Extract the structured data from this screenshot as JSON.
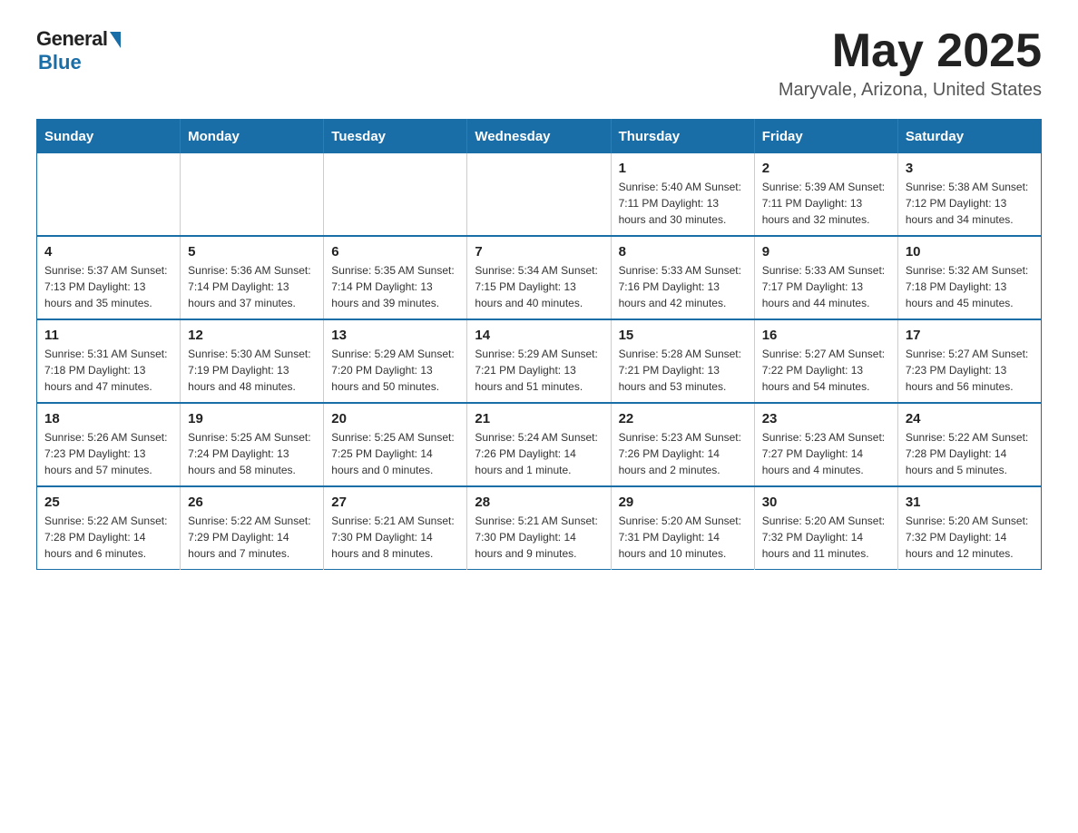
{
  "logo": {
    "general": "General",
    "blue": "Blue"
  },
  "title": {
    "month": "May 2025",
    "location": "Maryvale, Arizona, United States"
  },
  "calendar": {
    "headers": [
      "Sunday",
      "Monday",
      "Tuesday",
      "Wednesday",
      "Thursday",
      "Friday",
      "Saturday"
    ],
    "rows": [
      [
        {
          "day": "",
          "info": ""
        },
        {
          "day": "",
          "info": ""
        },
        {
          "day": "",
          "info": ""
        },
        {
          "day": "",
          "info": ""
        },
        {
          "day": "1",
          "info": "Sunrise: 5:40 AM\nSunset: 7:11 PM\nDaylight: 13 hours and 30 minutes."
        },
        {
          "day": "2",
          "info": "Sunrise: 5:39 AM\nSunset: 7:11 PM\nDaylight: 13 hours and 32 minutes."
        },
        {
          "day": "3",
          "info": "Sunrise: 5:38 AM\nSunset: 7:12 PM\nDaylight: 13 hours and 34 minutes."
        }
      ],
      [
        {
          "day": "4",
          "info": "Sunrise: 5:37 AM\nSunset: 7:13 PM\nDaylight: 13 hours and 35 minutes."
        },
        {
          "day": "5",
          "info": "Sunrise: 5:36 AM\nSunset: 7:14 PM\nDaylight: 13 hours and 37 minutes."
        },
        {
          "day": "6",
          "info": "Sunrise: 5:35 AM\nSunset: 7:14 PM\nDaylight: 13 hours and 39 minutes."
        },
        {
          "day": "7",
          "info": "Sunrise: 5:34 AM\nSunset: 7:15 PM\nDaylight: 13 hours and 40 minutes."
        },
        {
          "day": "8",
          "info": "Sunrise: 5:33 AM\nSunset: 7:16 PM\nDaylight: 13 hours and 42 minutes."
        },
        {
          "day": "9",
          "info": "Sunrise: 5:33 AM\nSunset: 7:17 PM\nDaylight: 13 hours and 44 minutes."
        },
        {
          "day": "10",
          "info": "Sunrise: 5:32 AM\nSunset: 7:18 PM\nDaylight: 13 hours and 45 minutes."
        }
      ],
      [
        {
          "day": "11",
          "info": "Sunrise: 5:31 AM\nSunset: 7:18 PM\nDaylight: 13 hours and 47 minutes."
        },
        {
          "day": "12",
          "info": "Sunrise: 5:30 AM\nSunset: 7:19 PM\nDaylight: 13 hours and 48 minutes."
        },
        {
          "day": "13",
          "info": "Sunrise: 5:29 AM\nSunset: 7:20 PM\nDaylight: 13 hours and 50 minutes."
        },
        {
          "day": "14",
          "info": "Sunrise: 5:29 AM\nSunset: 7:21 PM\nDaylight: 13 hours and 51 minutes."
        },
        {
          "day": "15",
          "info": "Sunrise: 5:28 AM\nSunset: 7:21 PM\nDaylight: 13 hours and 53 minutes."
        },
        {
          "day": "16",
          "info": "Sunrise: 5:27 AM\nSunset: 7:22 PM\nDaylight: 13 hours and 54 minutes."
        },
        {
          "day": "17",
          "info": "Sunrise: 5:27 AM\nSunset: 7:23 PM\nDaylight: 13 hours and 56 minutes."
        }
      ],
      [
        {
          "day": "18",
          "info": "Sunrise: 5:26 AM\nSunset: 7:23 PM\nDaylight: 13 hours and 57 minutes."
        },
        {
          "day": "19",
          "info": "Sunrise: 5:25 AM\nSunset: 7:24 PM\nDaylight: 13 hours and 58 minutes."
        },
        {
          "day": "20",
          "info": "Sunrise: 5:25 AM\nSunset: 7:25 PM\nDaylight: 14 hours and 0 minutes."
        },
        {
          "day": "21",
          "info": "Sunrise: 5:24 AM\nSunset: 7:26 PM\nDaylight: 14 hours and 1 minute."
        },
        {
          "day": "22",
          "info": "Sunrise: 5:23 AM\nSunset: 7:26 PM\nDaylight: 14 hours and 2 minutes."
        },
        {
          "day": "23",
          "info": "Sunrise: 5:23 AM\nSunset: 7:27 PM\nDaylight: 14 hours and 4 minutes."
        },
        {
          "day": "24",
          "info": "Sunrise: 5:22 AM\nSunset: 7:28 PM\nDaylight: 14 hours and 5 minutes."
        }
      ],
      [
        {
          "day": "25",
          "info": "Sunrise: 5:22 AM\nSunset: 7:28 PM\nDaylight: 14 hours and 6 minutes."
        },
        {
          "day": "26",
          "info": "Sunrise: 5:22 AM\nSunset: 7:29 PM\nDaylight: 14 hours and 7 minutes."
        },
        {
          "day": "27",
          "info": "Sunrise: 5:21 AM\nSunset: 7:30 PM\nDaylight: 14 hours and 8 minutes."
        },
        {
          "day": "28",
          "info": "Sunrise: 5:21 AM\nSunset: 7:30 PM\nDaylight: 14 hours and 9 minutes."
        },
        {
          "day": "29",
          "info": "Sunrise: 5:20 AM\nSunset: 7:31 PM\nDaylight: 14 hours and 10 minutes."
        },
        {
          "day": "30",
          "info": "Sunrise: 5:20 AM\nSunset: 7:32 PM\nDaylight: 14 hours and 11 minutes."
        },
        {
          "day": "31",
          "info": "Sunrise: 5:20 AM\nSunset: 7:32 PM\nDaylight: 14 hours and 12 minutes."
        }
      ]
    ]
  }
}
